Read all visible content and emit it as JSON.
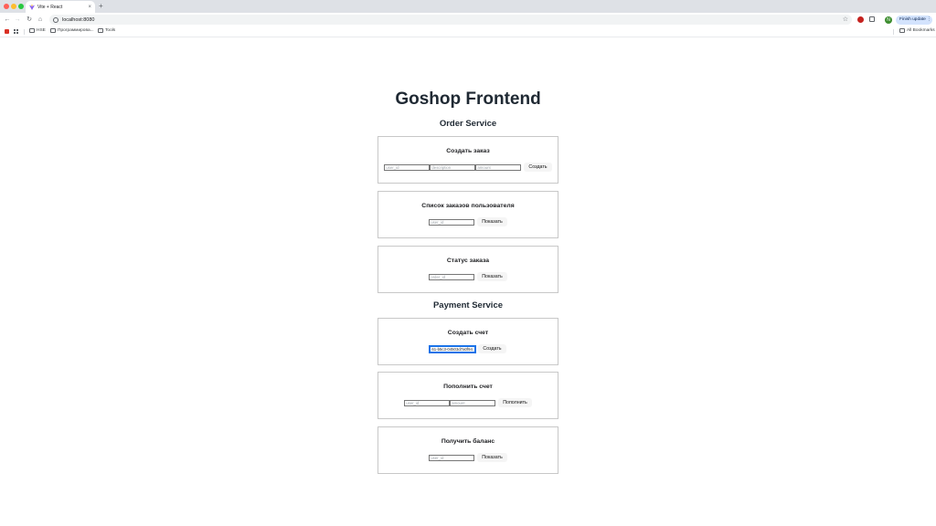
{
  "browser": {
    "tab_title": "Vite + React",
    "new_tab_symbol": "+",
    "close_symbol": "×",
    "url": "localhost:8080",
    "avatar_letter": "N",
    "update_button": "Finish update",
    "bookmarks": [
      "HSE",
      "Программирова...",
      "Tools"
    ],
    "all_bookmarks": "All Bookmarks",
    "colors": {
      "tab_strip": "#dee1e6",
      "update": "#d3e3fd",
      "avatar": "#3c8d2f"
    }
  },
  "page": {
    "title": "Goshop Frontend",
    "order_service": {
      "title": "Order Service",
      "create_order": {
        "title": "Создать заказ",
        "user_id_placeholder": "user_id",
        "description_placeholder": "description",
        "amount_placeholder": "amount",
        "button": "Создать"
      },
      "user_orders": {
        "title": "Список заказов пользователя",
        "user_id_placeholder": "user_id",
        "button": "Показать"
      },
      "order_status": {
        "title": "Статус заказа",
        "order_id_placeholder": "order_id",
        "button": "Показать"
      }
    },
    "payment_service": {
      "title": "Payment Service",
      "create_account": {
        "title": "Создать счет",
        "user_id_value": "61-b5c3-04503d7a0f94",
        "button": "Создать"
      },
      "top_up": {
        "title": "Пополнить счет",
        "user_id_placeholder": "user_id",
        "amount_placeholder": "amount",
        "button": "Пополнить"
      },
      "get_balance": {
        "title": "Получить баланс",
        "user_id_placeholder": "user_id",
        "button": "Показать"
      }
    }
  }
}
